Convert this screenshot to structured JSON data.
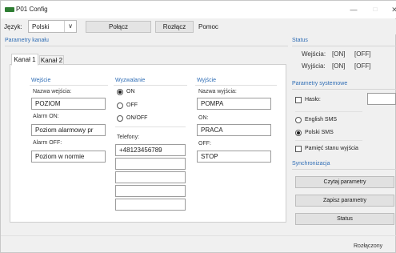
{
  "window": {
    "title": "P01 Config",
    "min_glyph": "—",
    "max_glyph": "□",
    "close_glyph": "✕"
  },
  "menubar": {
    "language_label": "Język:",
    "language_value": "Polski",
    "dropdown_glyph": "∨",
    "connect_label": "Połącz",
    "disconnect_label": "Rozłącz",
    "help_label": "Pomoc"
  },
  "channel_params": {
    "title": "Parametry kanału",
    "tabs": [
      {
        "label": "Kanał 1",
        "active": true
      },
      {
        "label": "Kanał 2",
        "active": false
      }
    ],
    "input": {
      "title": "Wejście",
      "name_label": "Nazwa wejścia:",
      "name_value": "POZIOM",
      "alarm_on_label": "Alarm ON:",
      "alarm_on_value": "Poziom alarmowy pr",
      "alarm_off_label": "Alarm OFF:",
      "alarm_off_value": "Poziom w normie"
    },
    "trigger": {
      "title": "Wyzwalanie",
      "options": [
        {
          "label": "ON",
          "checked": true
        },
        {
          "label": "OFF",
          "checked": false
        },
        {
          "label": "ON/OFF",
          "checked": false
        }
      ],
      "phones_label": "Telefony:",
      "phones": [
        "+48123456789",
        "",
        "",
        "",
        ""
      ]
    },
    "output": {
      "title": "Wyjście",
      "name_label": "Nazwa wyjścia:",
      "name_value": "POMPA",
      "on_label": "ON:",
      "on_value": "PRACA",
      "off_label": "OFF:",
      "off_value": "STOP"
    }
  },
  "status": {
    "title": "Status",
    "inputs_label": "Wejścia:",
    "inputs_on": "[ON]",
    "inputs_off": "[OFF]",
    "outputs_label": "Wyjścia:",
    "outputs_on": "[ON]",
    "outputs_off": "[OFF]"
  },
  "system_params": {
    "title": "Parametry systemowe",
    "password_label": "Hasło:",
    "password_value": "",
    "sms_options": [
      {
        "label": "English SMS",
        "checked": false
      },
      {
        "label": "Polski SMS",
        "checked": true
      }
    ],
    "memory_label": "Pamięć stanu wyjścia"
  },
  "sync": {
    "title": "Synchronizacja",
    "read_label": "Czytaj parametry",
    "write_label": "Zapisz parametry",
    "status_label": "Status"
  },
  "statusbar": {
    "text": "Rozłączony"
  },
  "colors": {
    "accent": "#2f6db5",
    "window_bg": "#f0f0f0",
    "app_icon": "#2e7d32"
  }
}
